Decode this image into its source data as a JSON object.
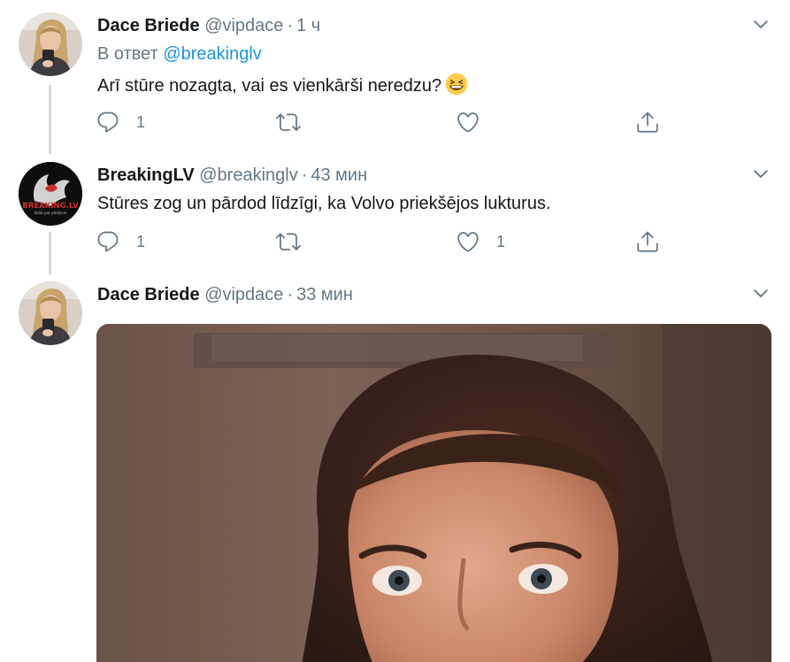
{
  "tweets": [
    {
      "author_name": "Dace Briede",
      "handle": "@vipdace",
      "separator": "·",
      "time": "1 ч",
      "reply_prefix": "В ответ",
      "reply_mention": "@breakinglv",
      "text": "Arī stūre nozagta, vai es vienkārši neredzu?",
      "emoji": "grinning-squinting-face",
      "reply_count": "1",
      "retweet_count": "",
      "like_count": "",
      "avatar": "woman-selfie-avatar"
    },
    {
      "author_name": "BreakingLV",
      "handle": "@breakinglv",
      "separator": "·",
      "time": "43 мин",
      "text": "Stūres zog un pārdod līdzīgi, ka Volvo priekšējos lukturus.",
      "reply_count": "1",
      "retweet_count": "",
      "like_count": "1",
      "avatar": "breakinglv-logo-avatar",
      "avatar_text": "BREAKING.LV",
      "avatar_subtext": "ātrāk par pārējiem"
    },
    {
      "author_name": "Dace Briede",
      "handle": "@vipdace",
      "separator": "·",
      "time": "33 мин",
      "media": "gif-woman-confused-face",
      "avatar": "woman-selfie-avatar"
    }
  ],
  "colors": {
    "text": "#14171a",
    "secondary": "#657786",
    "link": "#1b95e0",
    "thread_line": "#cfd9de"
  },
  "icons": {
    "reply": "reply-icon",
    "retweet": "retweet-icon",
    "like": "heart-icon",
    "share": "share-icon",
    "caret": "chevron-down-icon"
  }
}
